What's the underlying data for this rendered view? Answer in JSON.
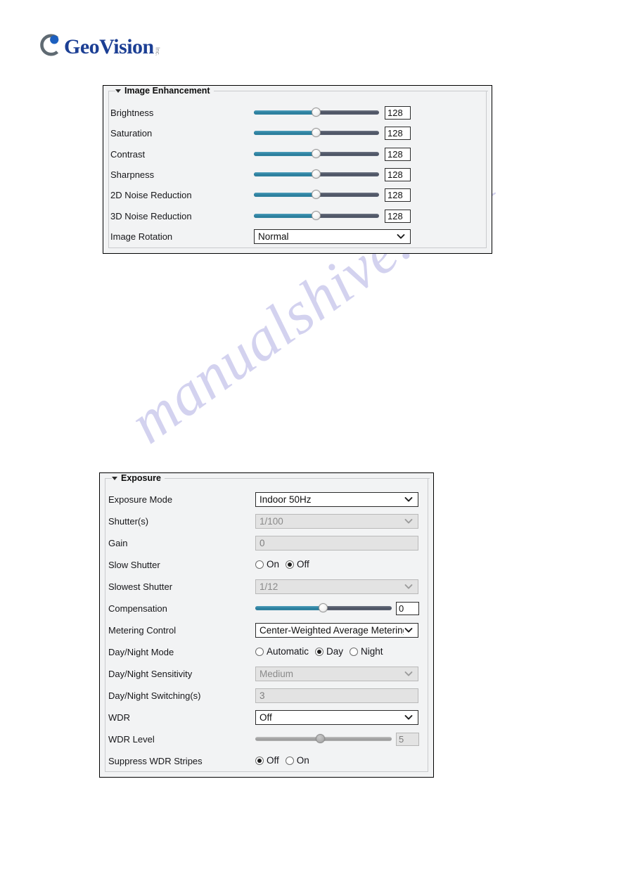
{
  "brand": {
    "name": "GeoVision",
    "suffix": "Inc.",
    "logo_icon": "geovision-c-mark",
    "color": "#1c3f94"
  },
  "watermark": {
    "text": "manualshive.com",
    "color": "#b9b8e6"
  },
  "panels": [
    {
      "id": "image-enhancement",
      "title": "Image Enhancement",
      "collapse_icon": "triangle-down-icon",
      "rows": [
        {
          "label": "Brightness",
          "type": "slider",
          "value": "128",
          "percent": 50,
          "disabled": false
        },
        {
          "label": "Saturation",
          "type": "slider",
          "value": "128",
          "percent": 50,
          "disabled": false
        },
        {
          "label": "Contrast",
          "type": "slider",
          "value": "128",
          "percent": 50,
          "disabled": false
        },
        {
          "label": "Sharpness",
          "type": "slider",
          "value": "128",
          "percent": 50,
          "disabled": false
        },
        {
          "label": "2D Noise Reduction",
          "type": "slider",
          "value": "128",
          "percent": 50,
          "disabled": false
        },
        {
          "label": "3D Noise Reduction",
          "type": "slider",
          "value": "128",
          "percent": 50,
          "disabled": false
        },
        {
          "label": "Image Rotation",
          "type": "select",
          "value": "Normal",
          "disabled": false,
          "chevron_icon": "chevron-down-icon"
        }
      ]
    },
    {
      "id": "exposure",
      "title": "Exposure",
      "collapse_icon": "triangle-down-icon",
      "rows": [
        {
          "label": "Exposure Mode",
          "type": "select",
          "value": "Indoor 50Hz",
          "disabled": false,
          "chevron_icon": "chevron-down-icon"
        },
        {
          "label": "Shutter(s)",
          "type": "select",
          "value": "1/100",
          "disabled": true,
          "chevron_icon": "chevron-down-icon"
        },
        {
          "label": "Gain",
          "type": "text",
          "value": "0",
          "disabled": true
        },
        {
          "label": "Slow Shutter",
          "type": "radio",
          "options": [
            "On",
            "Off"
          ],
          "selected": "Off"
        },
        {
          "label": "Slowest Shutter",
          "type": "select",
          "value": "1/12",
          "disabled": true,
          "chevron_icon": "chevron-down-icon"
        },
        {
          "label": "Compensation",
          "type": "slider",
          "value": "0",
          "percent": 50,
          "disabled": false
        },
        {
          "label": "Metering Control",
          "type": "select",
          "value": "Center-Weighted Average Metering",
          "disabled": false,
          "chevron_icon": "chevron-down-icon"
        },
        {
          "label": "Day/Night Mode",
          "type": "radio",
          "options": [
            "Automatic",
            "Day",
            "Night"
          ],
          "selected": "Day"
        },
        {
          "label": "Day/Night Sensitivity",
          "type": "select",
          "value": "Medium",
          "disabled": true,
          "chevron_icon": "chevron-down-icon"
        },
        {
          "label": "Day/Night Switching(s)",
          "type": "text",
          "value": "3",
          "disabled": true
        },
        {
          "label": "WDR",
          "type": "select",
          "value": "Off",
          "disabled": false,
          "chevron_icon": "chevron-down-icon"
        },
        {
          "label": "WDR Level",
          "type": "slider",
          "value": "5",
          "percent": 48,
          "disabled": true
        },
        {
          "label": "Suppress WDR Stripes",
          "type": "radio",
          "options": [
            "Off",
            "On"
          ],
          "selected": "Off"
        }
      ]
    }
  ],
  "colors": {
    "slider_fill": "#2a7e9e",
    "slider_track": "#4b5262",
    "panel_bg": "#f2f3f4",
    "disabled_bg": "#e3e3e3"
  }
}
